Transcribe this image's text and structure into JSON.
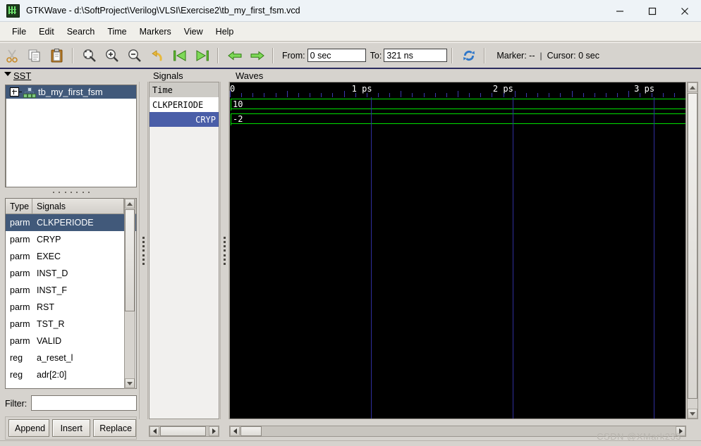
{
  "window": {
    "title": "GTKWave - d:\\SoftProject\\Verilog\\VLSI\\Exercise2\\tb_my_first_fsm.vcd",
    "app_icon": "gtkwave-icon",
    "minimize": "—",
    "maximize": "□",
    "close": "✕"
  },
  "menu": {
    "items": [
      {
        "label": "File"
      },
      {
        "label": "Edit"
      },
      {
        "label": "Search"
      },
      {
        "label": "Time"
      },
      {
        "label": "Markers"
      },
      {
        "label": "View"
      },
      {
        "label": "Help"
      }
    ]
  },
  "toolbar": {
    "buttons": [
      {
        "name": "cut-icon",
        "title": "Cut"
      },
      {
        "name": "copy-icon",
        "title": "Copy"
      },
      {
        "name": "paste-icon",
        "title": "Paste"
      },
      {
        "name": "zoom-fit-icon",
        "title": "Zoom Fit"
      },
      {
        "name": "zoom-in-icon",
        "title": "Zoom In"
      },
      {
        "name": "zoom-out-icon",
        "title": "Zoom Out"
      },
      {
        "name": "zoom-undo-icon",
        "title": "Zoom Undo"
      },
      {
        "name": "zoom-to-start-icon",
        "title": "Zoom To Start"
      },
      {
        "name": "zoom-to-end-icon",
        "title": "Zoom To End"
      },
      {
        "name": "prev-edge-icon",
        "title": "Previous Edge"
      },
      {
        "name": "next-edge-icon",
        "title": "Next Edge"
      },
      {
        "name": "reload-icon",
        "title": "Reload"
      }
    ],
    "from_label": "From:",
    "from_value": "0 sec",
    "to_label": "To:",
    "to_value": "321 ns",
    "marker_status": "Marker: --",
    "cursor_status": "Cursor: 0 sec",
    "separator": "|"
  },
  "sst": {
    "title": "SST",
    "collapse_icon": "chevron-down-icon",
    "tree": [
      {
        "label": "tb_my_first_fsm",
        "expand": "+",
        "selected": true
      }
    ]
  },
  "signal_table": {
    "columns": [
      "Type",
      "Signals"
    ],
    "rows": [
      {
        "type": "parm",
        "name": "CLKPERIODE",
        "selected": true
      },
      {
        "type": "parm",
        "name": "CRYP",
        "selected": false
      },
      {
        "type": "parm",
        "name": "EXEC",
        "selected": false
      },
      {
        "type": "parm",
        "name": "INST_D",
        "selected": false
      },
      {
        "type": "parm",
        "name": "INST_F",
        "selected": false
      },
      {
        "type": "parm",
        "name": "RST",
        "selected": false
      },
      {
        "type": "parm",
        "name": "TST_R",
        "selected": false
      },
      {
        "type": "parm",
        "name": "VALID",
        "selected": false
      },
      {
        "type": "reg",
        "name": "a_reset_l",
        "selected": false
      },
      {
        "type": "reg",
        "name": "adr[2:0]",
        "selected": false
      }
    ]
  },
  "filter": {
    "label": "Filter:",
    "value": "",
    "placeholder": ""
  },
  "actions": {
    "append": "Append",
    "insert": "Insert",
    "replace": "Replace"
  },
  "signals_pane": {
    "title": "Signals",
    "rows": [
      {
        "label": "Time",
        "style": "header"
      },
      {
        "label": "CLKPERIODE",
        "style": "plain"
      },
      {
        "label": "CRYP",
        "style": "selected"
      }
    ]
  },
  "waves_pane": {
    "title": "Waves",
    "time_ruler": {
      "ticks": [
        {
          "label": "0",
          "pos_pct": 0.2
        },
        {
          "label": "1 ps",
          "pos_pct": 31.0
        },
        {
          "label": "2 ps",
          "pos_pct": 62.0
        },
        {
          "label": "3 ps",
          "pos_pct": 93.0
        }
      ],
      "minor_tick_count": 40
    },
    "traces": [
      {
        "signal": "CLKPERIODE",
        "value": "10",
        "color": "#00e000"
      },
      {
        "signal": "CRYP",
        "value": "-2",
        "color": "#00e000"
      }
    ],
    "gridlines_pct": [
      31.0,
      62.0,
      93.0
    ]
  },
  "watermark": {
    "text": "CSDN @XMark233"
  },
  "colors": {
    "selection": "#41597a",
    "signal_selection": "#4a5ea8",
    "wave_bg": "#000000",
    "wave_trace": "#00e000",
    "grid": "#2f2f9e",
    "chrome": "#d6d3ce"
  }
}
